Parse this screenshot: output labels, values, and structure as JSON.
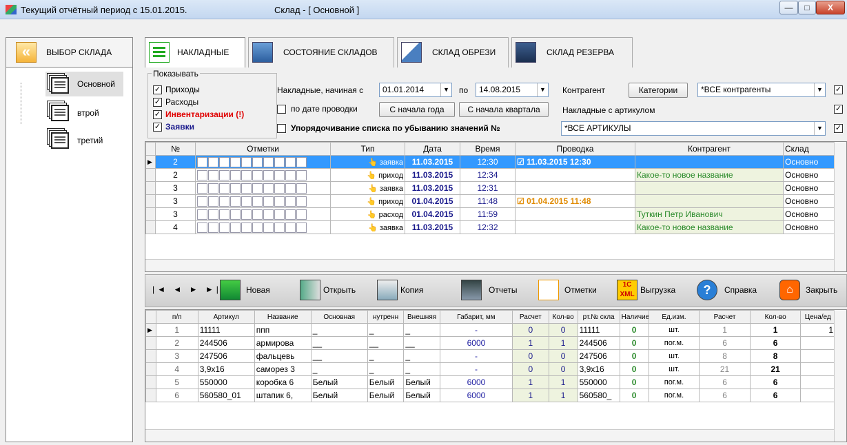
{
  "window": {
    "title": "Текущий отчётный период с  15.01.2015.",
    "subtitle": "Склад - [ Основной ]",
    "min": "—",
    "max": "□",
    "close": "X"
  },
  "left": {
    "select_label": "ВЫБОР СКЛАДА",
    "warehouses": [
      "Основной",
      "втрой",
      "третий"
    ]
  },
  "tabs": [
    {
      "label": "НАКЛАДНЫЕ"
    },
    {
      "label": "СОСТОЯНИЕ СКЛАДОВ"
    },
    {
      "label": "СКЛАД ОБРЕЗИ"
    },
    {
      "label": "СКЛАД РЕЗЕРВА"
    }
  ],
  "filter": {
    "show_label": "Показывать",
    "incoming": "Приходы",
    "outgoing": "Расходы",
    "inventory": "Инвентаризации (!)",
    "requests": "Заявки",
    "from_label": "Накладные, начиная с",
    "from_date": "01.01.2014",
    "to_label": "по",
    "to_date": "14.08.2015",
    "contractor_label": "Контрагент",
    "categories_btn": "Категории",
    "contractor_value": "*ВСЕ контрагенты",
    "by_posting": "по дате проводки",
    "year_start": "С начала года",
    "quarter_start": "С начала квартала",
    "article_label": "Накладные с артикулом",
    "article_value": "*ВСЕ АРТИКУЛЫ",
    "sort_desc": "Упорядочивание списка по убыванию значений №"
  },
  "invoices": {
    "headers": [
      "№",
      "Отметки",
      "Тип",
      "Дата",
      "Время",
      "Проводка",
      "Контрагент",
      "Склад"
    ],
    "rows": [
      {
        "num": "2",
        "type": "заявка",
        "date": "11.03.2015",
        "time": "12:30",
        "pdate": "11.03.2015",
        "ptime": "12:30",
        "contr": "",
        "wh": "Основно"
      },
      {
        "num": "2",
        "type": "приход",
        "date": "11.03.2015",
        "time": "12:34",
        "pdate": "",
        "ptime": "",
        "contr": "Какое-то новое название",
        "wh": "Основно"
      },
      {
        "num": "3",
        "type": "заявка",
        "date": "11.03.2015",
        "time": "12:31",
        "pdate": "",
        "ptime": "",
        "contr": "",
        "wh": "Основно"
      },
      {
        "num": "3",
        "type": "приход",
        "date": "01.04.2015",
        "time": "11:48",
        "pdate": "01.04.2015",
        "ptime": "11:48",
        "contr": "",
        "wh": "Основно"
      },
      {
        "num": "3",
        "type": "расход",
        "date": "01.04.2015",
        "time": "11:59",
        "pdate": "",
        "ptime": "",
        "contr": "Туткин Петр Иванович",
        "wh": "Основно"
      },
      {
        "num": "4",
        "type": "заявка",
        "date": "11.03.2015",
        "time": "12:32",
        "pdate": "",
        "ptime": "",
        "contr": "Какое-то новое название",
        "wh": "Основно"
      }
    ]
  },
  "toolbar": {
    "new": "Новая",
    "open": "Открыть",
    "copy": "Копия",
    "reports": "Отчеты",
    "marks": "Отметки",
    "export": "Выгрузка",
    "help": "Справка",
    "close": "Закрыть",
    "export_icon": "1С XML"
  },
  "items": {
    "headers": [
      "п/п",
      "Артикул",
      "Название",
      "Основная",
      "нутренн",
      "Внешняя",
      "Габарит, мм",
      "Расчет",
      "Кол-во",
      "рт.№ скла",
      "Наличие",
      "Ед.изм.",
      "Расчет",
      "Кол-во",
      "Цена/ед"
    ],
    "rows": [
      [
        "1",
        "11111",
        "ппп",
        "_",
        "_",
        "_",
        "-",
        "0",
        "0",
        "11111",
        "0",
        "шт.",
        "1",
        "1",
        "1"
      ],
      [
        "2",
        "244506",
        "армирова",
        "__",
        "__",
        "__",
        "6000",
        "1",
        "1",
        "244506",
        "0",
        "пог.м.",
        "6",
        "6",
        ""
      ],
      [
        "3",
        "247506",
        "фальцевь",
        "__",
        "_",
        "_",
        "-",
        "0",
        "0",
        "247506",
        "0",
        "шт.",
        "8",
        "8",
        ""
      ],
      [
        "4",
        "3,9x16",
        "саморез 3",
        "_",
        "_",
        "_",
        "-",
        "0",
        "0",
        "3,9x16",
        "0",
        "шт.",
        "21",
        "21",
        ""
      ],
      [
        "5",
        "550000",
        "коробка 6",
        "Белый",
        "Белый",
        "Белый",
        "6000",
        "1",
        "1",
        "550000",
        "0",
        "пог.м.",
        "6",
        "6",
        ""
      ],
      [
        "6",
        "560580_01",
        "штапик 6,",
        "Белый",
        "Белый",
        "Белый",
        "6000",
        "1",
        "1",
        "560580_",
        "0",
        "пог.м.",
        "6",
        "6",
        ""
      ]
    ]
  },
  "nav": {
    "first": "|◄",
    "prev": "◄",
    "next": "►",
    "last": "►|"
  }
}
